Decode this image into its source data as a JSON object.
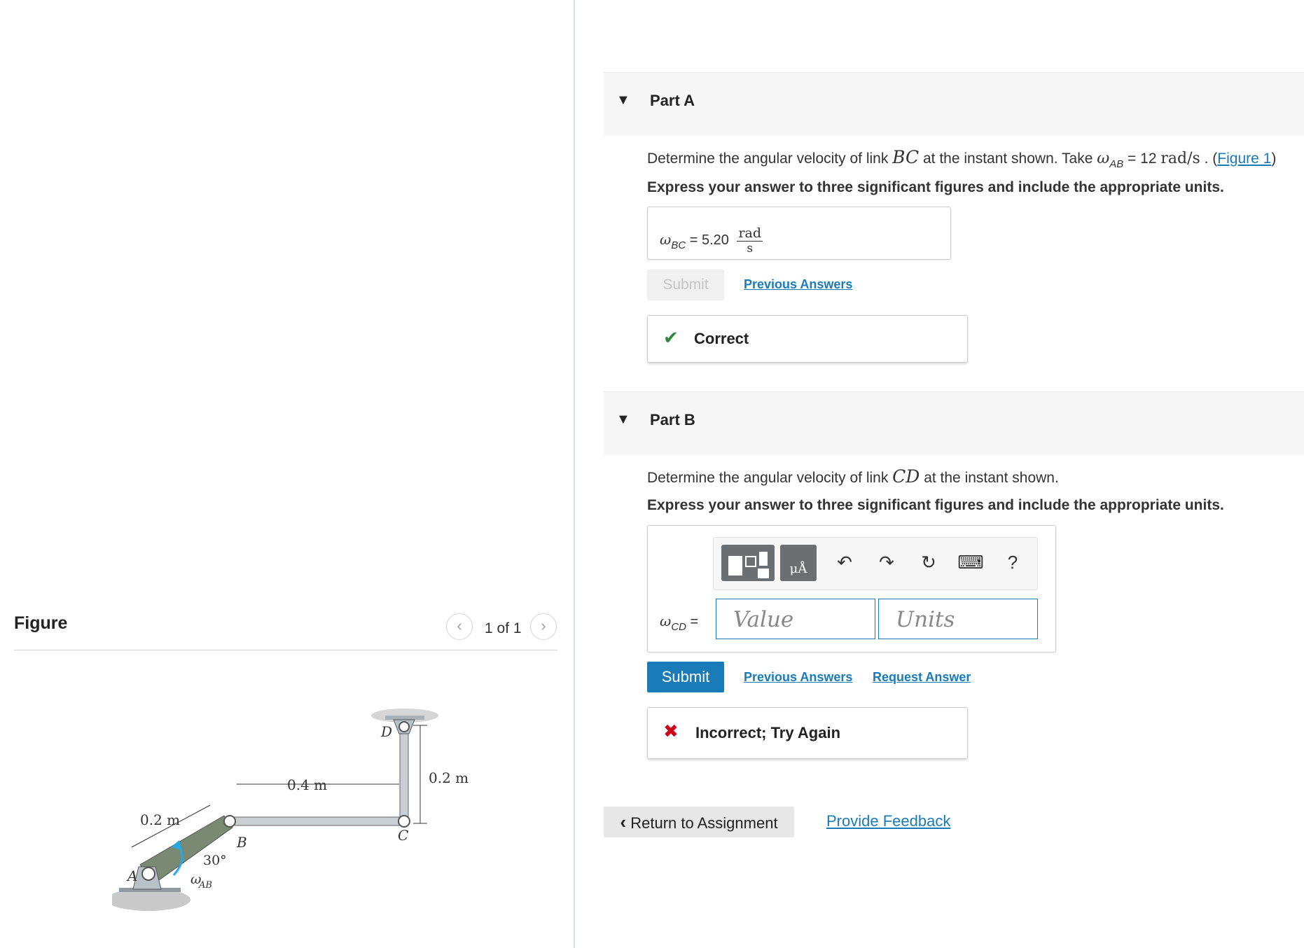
{
  "figure_panel": {
    "title": "Figure",
    "pager": {
      "text": "1 of 1",
      "prev_icon": "chevron-left",
      "next_icon": "chevron-right"
    },
    "diagram_labels": {
      "point_a": "A",
      "point_b": "B",
      "point_c": "C",
      "point_d": "D",
      "dim_ab": "0.2 m",
      "dim_bc": "0.4 m",
      "dim_cd": "0.2 m",
      "angle": "30°",
      "omega_ab": "ω",
      "omega_ab_sub": "AB"
    }
  },
  "part_a": {
    "label": "Part A",
    "question_pre": "Determine the angular velocity of link ",
    "link_name": "BC",
    "question_mid": " at the instant shown. Take ",
    "omega": "ω",
    "omega_sub": "AB",
    "equals_value": " = 12 ",
    "units": "rad/s",
    "dot": " . (",
    "figure_link": "Figure 1",
    "close_paren": ")",
    "instruction": "Express your answer to three significant figures and include the appropriate units.",
    "answer": {
      "symbol": "ω",
      "symbol_sub": "BC",
      "equals": " = ",
      "value": "5.20",
      "unit_num": "rad",
      "unit_den": "s"
    },
    "submit_label": "Submit",
    "previous_answers_label": "Previous Answers",
    "feedback": {
      "icon": "✔",
      "text": "Correct",
      "color": "#2e8b3d"
    }
  },
  "part_b": {
    "label": "Part B",
    "question_pre": "Determine the angular velocity of link ",
    "link_name": "CD",
    "question_post": " at the instant shown.",
    "instruction": "Express your answer to three significant figures and include the appropriate units.",
    "toolbar": {
      "template_icon": "templates-icon",
      "units_icon": "units-icon",
      "units_glyph": "μÅ",
      "undo": "↶",
      "redo": "↷",
      "reset": "↻",
      "keyboard": "⌨",
      "help": "?"
    },
    "answer": {
      "symbol": "ω",
      "symbol_sub": "CD",
      "equals": " =",
      "value_placeholder": "Value",
      "units_placeholder": "Units"
    },
    "submit_label": "Submit",
    "previous_answers_label": "Previous Answers",
    "request_answer_label": "Request Answer",
    "feedback": {
      "icon": "✖",
      "text": "Incorrect; Try Again",
      "color": "#d0021b"
    }
  },
  "footer": {
    "return_label": "Return to Assignment",
    "return_icon": "‹",
    "provide_feedback_label": "Provide Feedback"
  },
  "colors": {
    "link": "#1a7bb9",
    "accent": "#1a7bb9"
  }
}
